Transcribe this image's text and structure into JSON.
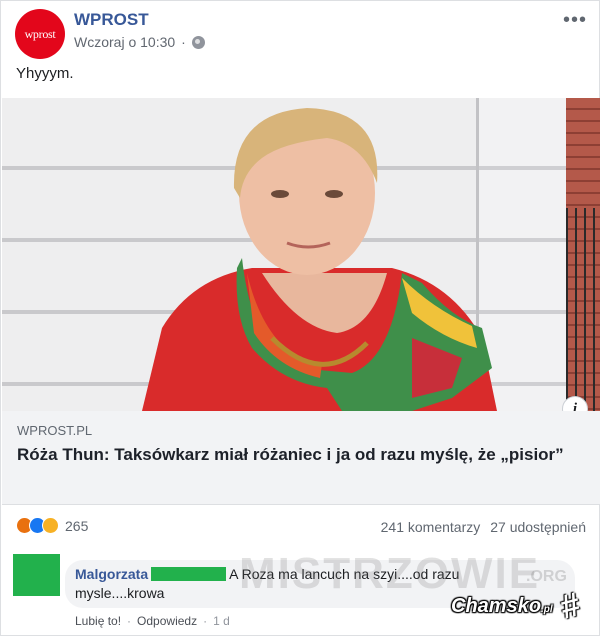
{
  "post": {
    "page_name": "WPROST",
    "avatar_text": "wprost",
    "timestamp": "Wczoraj o 10:30",
    "text": "Yhyyym.",
    "more": "•••"
  },
  "link": {
    "domain": "WPROST.PL",
    "headline": "Róża Thun: Taksówkarz miał różaniec i ja od razu myślę, że „pisior”",
    "info": "i"
  },
  "reactions": {
    "count": "265",
    "types": [
      "angry",
      "like",
      "haha"
    ]
  },
  "stats": {
    "comments": "241 komentarzy",
    "shares": "27 udostępnień"
  },
  "comment": {
    "author": "Malgorzata",
    "text_part1": "A Roza ma lancuch na szyi....od razu",
    "text_part2": "mysle....krowa",
    "like_action": "Lubię to!",
    "reply_action": "Odpowiedz",
    "time": "1 d"
  },
  "watermarks": {
    "mistrzowie": "MISTRZOWIE",
    "org": ".ORG",
    "chamsko": "Chamsko",
    "chamsko_pl": ".pl",
    "hash": "#"
  },
  "colors": {
    "link_blue": "#385898",
    "brand_red": "#e3061b",
    "redaction_green": "#22b14c"
  }
}
